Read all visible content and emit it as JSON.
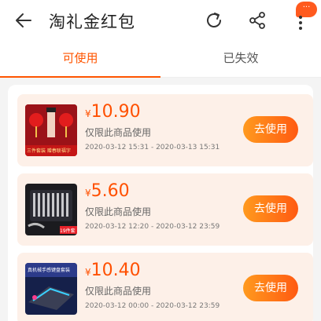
{
  "header": {
    "title": "淘礼金红包",
    "more_badge": "···"
  },
  "tabs": [
    {
      "label": "可使用",
      "active": true
    },
    {
      "label": "已失效",
      "active": false
    }
  ],
  "coupons": [
    {
      "currency": "¥",
      "amount": "10.90",
      "limit": "仅限此商品使用",
      "period": "2020-03-12 15:31 - 2020-03-13 15:31",
      "button": "去使用",
      "thumb_caption": "三件套装 赠春联福字"
    },
    {
      "currency": "¥",
      "amount": "5.60",
      "limit": "仅限此商品使用",
      "period": "2020-03-12 12:20 - 2020-03-12 23:59",
      "button": "去使用",
      "thumb_caption": "19件套"
    },
    {
      "currency": "¥",
      "amount": "10.40",
      "limit": "仅限此商品使用",
      "period": "2020-03-12 00:00 - 2020-03-12 23:59",
      "button": "去使用",
      "thumb_caption": "真机械手感键盘套装"
    }
  ],
  "colors": {
    "accent": "#ff5500",
    "card_bg": "#fdf0e8",
    "button_start": "#ff9a1e",
    "button_end": "#ff5a12"
  },
  "icons": [
    "back-arrow-icon",
    "refresh-icon",
    "share-icon",
    "more-icon"
  ]
}
